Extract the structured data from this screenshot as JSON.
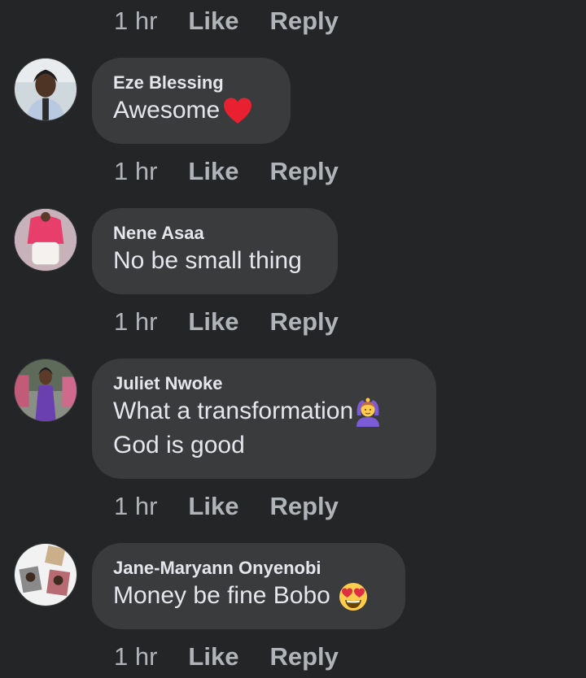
{
  "actions": {
    "time": "1 hr",
    "like": "Like",
    "reply": "Reply"
  },
  "comments": [
    {
      "author": "Eze Blessing",
      "lines": [
        "Awesome"
      ],
      "emoji": "red-heart-icon"
    },
    {
      "author": "Nene Asaa",
      "lines": [
        "No be small thing"
      ],
      "emoji": ""
    },
    {
      "author": "Juliet Nwoke",
      "lines": [
        "What a transformation",
        "God is good"
      ],
      "emoji": "person-gesturing-ok-icon"
    },
    {
      "author": "Jane-Maryann Onyenobi",
      "lines": [
        "Money be fine Bobo"
      ],
      "emoji": "heart-eyes-face-icon"
    }
  ],
  "colors": {
    "background": "#242526",
    "bubble": "#3a3b3c",
    "primary_text": "#e4e6eb",
    "secondary_text": "#b0b3b8",
    "heart": "#e8202f"
  }
}
